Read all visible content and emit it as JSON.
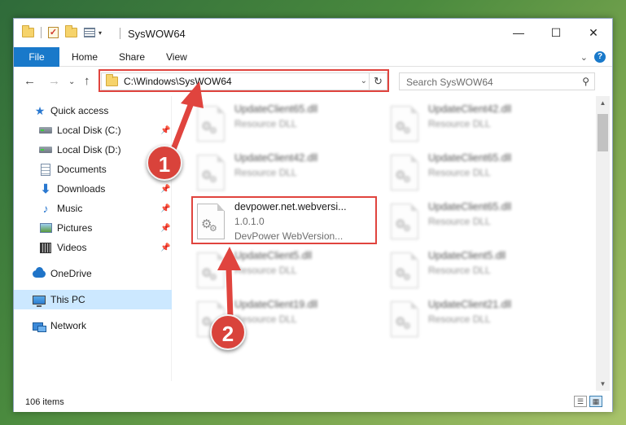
{
  "window": {
    "title": "SysWOW64",
    "controls": {
      "minimize": "—",
      "maximize": "☐",
      "close": "✕"
    }
  },
  "ribbon": {
    "tabs": [
      "File",
      "Home",
      "Share",
      "View"
    ],
    "expand_glyph": "⌄",
    "help_glyph": "?"
  },
  "navigation": {
    "back_glyph": "←",
    "forward_glyph": "→",
    "recent_glyph": "⌄",
    "up_glyph": "↑"
  },
  "address": {
    "path": "C:\\Windows\\SysWOW64",
    "dropdown_glyph": "⌄",
    "refresh_glyph": "↻"
  },
  "search": {
    "placeholder": "Search SysWOW64",
    "icon_glyph": "⚲"
  },
  "sidebar": {
    "items": [
      {
        "label": "Quick access",
        "icon": "star-icon"
      },
      {
        "label": "Local Disk (C:)",
        "icon": "drive-icon",
        "pinned": true
      },
      {
        "label": "Local Disk (D:)",
        "icon": "drive-icon",
        "pinned": false
      },
      {
        "label": "Documents",
        "icon": "documents-icon",
        "pinned": true
      },
      {
        "label": "Downloads",
        "icon": "downloads-icon",
        "pinned": true
      },
      {
        "label": "Music",
        "icon": "music-icon",
        "pinned": true
      },
      {
        "label": "Pictures",
        "icon": "pictures-icon",
        "pinned": true
      },
      {
        "label": "Videos",
        "icon": "videos-icon",
        "pinned": true
      },
      {
        "label": "OneDrive",
        "icon": "onedrive-icon"
      },
      {
        "label": "This PC",
        "icon": "this-pc-icon",
        "selected": true
      },
      {
        "label": "Network",
        "icon": "network-icon"
      }
    ],
    "pin_glyph": "📌"
  },
  "files": [
    {
      "name": "UpdateClient65.dll",
      "line2": "Resource DLL",
      "line3": "",
      "blurred": true
    },
    {
      "name": "UpdateClient42.dll",
      "line2": "Resource DLL",
      "line3": "",
      "blurred": true
    },
    {
      "name": "UpdateClient42.dll",
      "line2": "Resource DLL",
      "line3": "",
      "blurred": true
    },
    {
      "name": "UpdateClient65.dll",
      "line2": "Resource DLL",
      "line3": "",
      "blurred": true
    },
    {
      "name": "devpower.net.webversi...",
      "line2": "1.0.1.0",
      "line3": "DevPower WebVersion...",
      "blurred": false
    },
    {
      "name": "UpdateClient65.dll",
      "line2": "Resource DLL",
      "line3": "",
      "blurred": true
    },
    {
      "name": "UpdateClient5.dll",
      "line2": "Resource DLL",
      "line3": "",
      "blurred": true
    },
    {
      "name": "UpdateClient5.dll",
      "line2": "Resource DLL",
      "line3": "",
      "blurred": true
    },
    {
      "name": "UpdateClient19.dll",
      "line2": "Resource DLL",
      "line3": "",
      "blurred": true
    },
    {
      "name": "UpdateClient21.dll",
      "line2": "Resource DLL",
      "line3": "",
      "blurred": true
    }
  ],
  "status": {
    "item_count": "106 items"
  },
  "annotations": {
    "step1": "1",
    "step2": "2",
    "color": "#e0443e"
  }
}
